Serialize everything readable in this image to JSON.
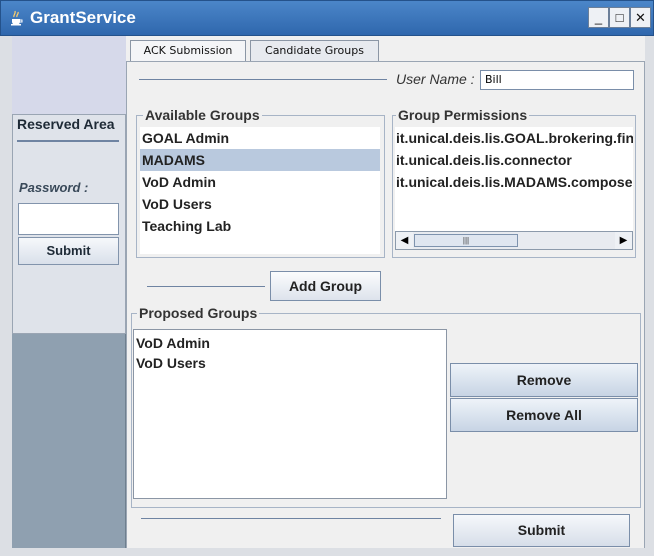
{
  "window": {
    "title": "GrantService",
    "icon": "java-cup-icon",
    "controls": {
      "minimize": "_",
      "maximize": "□",
      "close": "✕"
    }
  },
  "left_panel": {
    "reserved_title": "Reserved Area",
    "password_label": "Password :",
    "password_value": "",
    "submit_label": "Submit"
  },
  "tabs": [
    {
      "label": "ACK Submission",
      "selected": true
    },
    {
      "label": "Candidate Groups",
      "selected": false
    }
  ],
  "user": {
    "label": "User Name :",
    "value": "Bill"
  },
  "available_groups": {
    "title": "Available Groups",
    "items": [
      "GOAL Admin",
      "MADAMS",
      "VoD Admin",
      "VoD Users",
      "Teaching Lab"
    ],
    "selected": "MADAMS"
  },
  "group_permissions": {
    "title": "Group Permissions",
    "items": [
      "it.unical.deis.lis.GOAL.brokering.fin",
      "it.unical.deis.lis.connector",
      "it.unical.deis.lis.MADAMS.compose"
    ],
    "scrollbar": {
      "left_arrow": "◀",
      "right_arrow": "▶",
      "thumb_grip": "|||"
    }
  },
  "add_group_label": "Add Group",
  "proposed_groups": {
    "title": "Proposed Groups",
    "items": [
      "VoD Admin",
      "VoD Users"
    ]
  },
  "remove_label": "Remove",
  "remove_all_label": "Remove All",
  "submit_label": "Submit",
  "colors": {
    "titlebar": "#2f67ad",
    "left_panel": "#8fa0b0",
    "selection": "#b9c9de"
  }
}
